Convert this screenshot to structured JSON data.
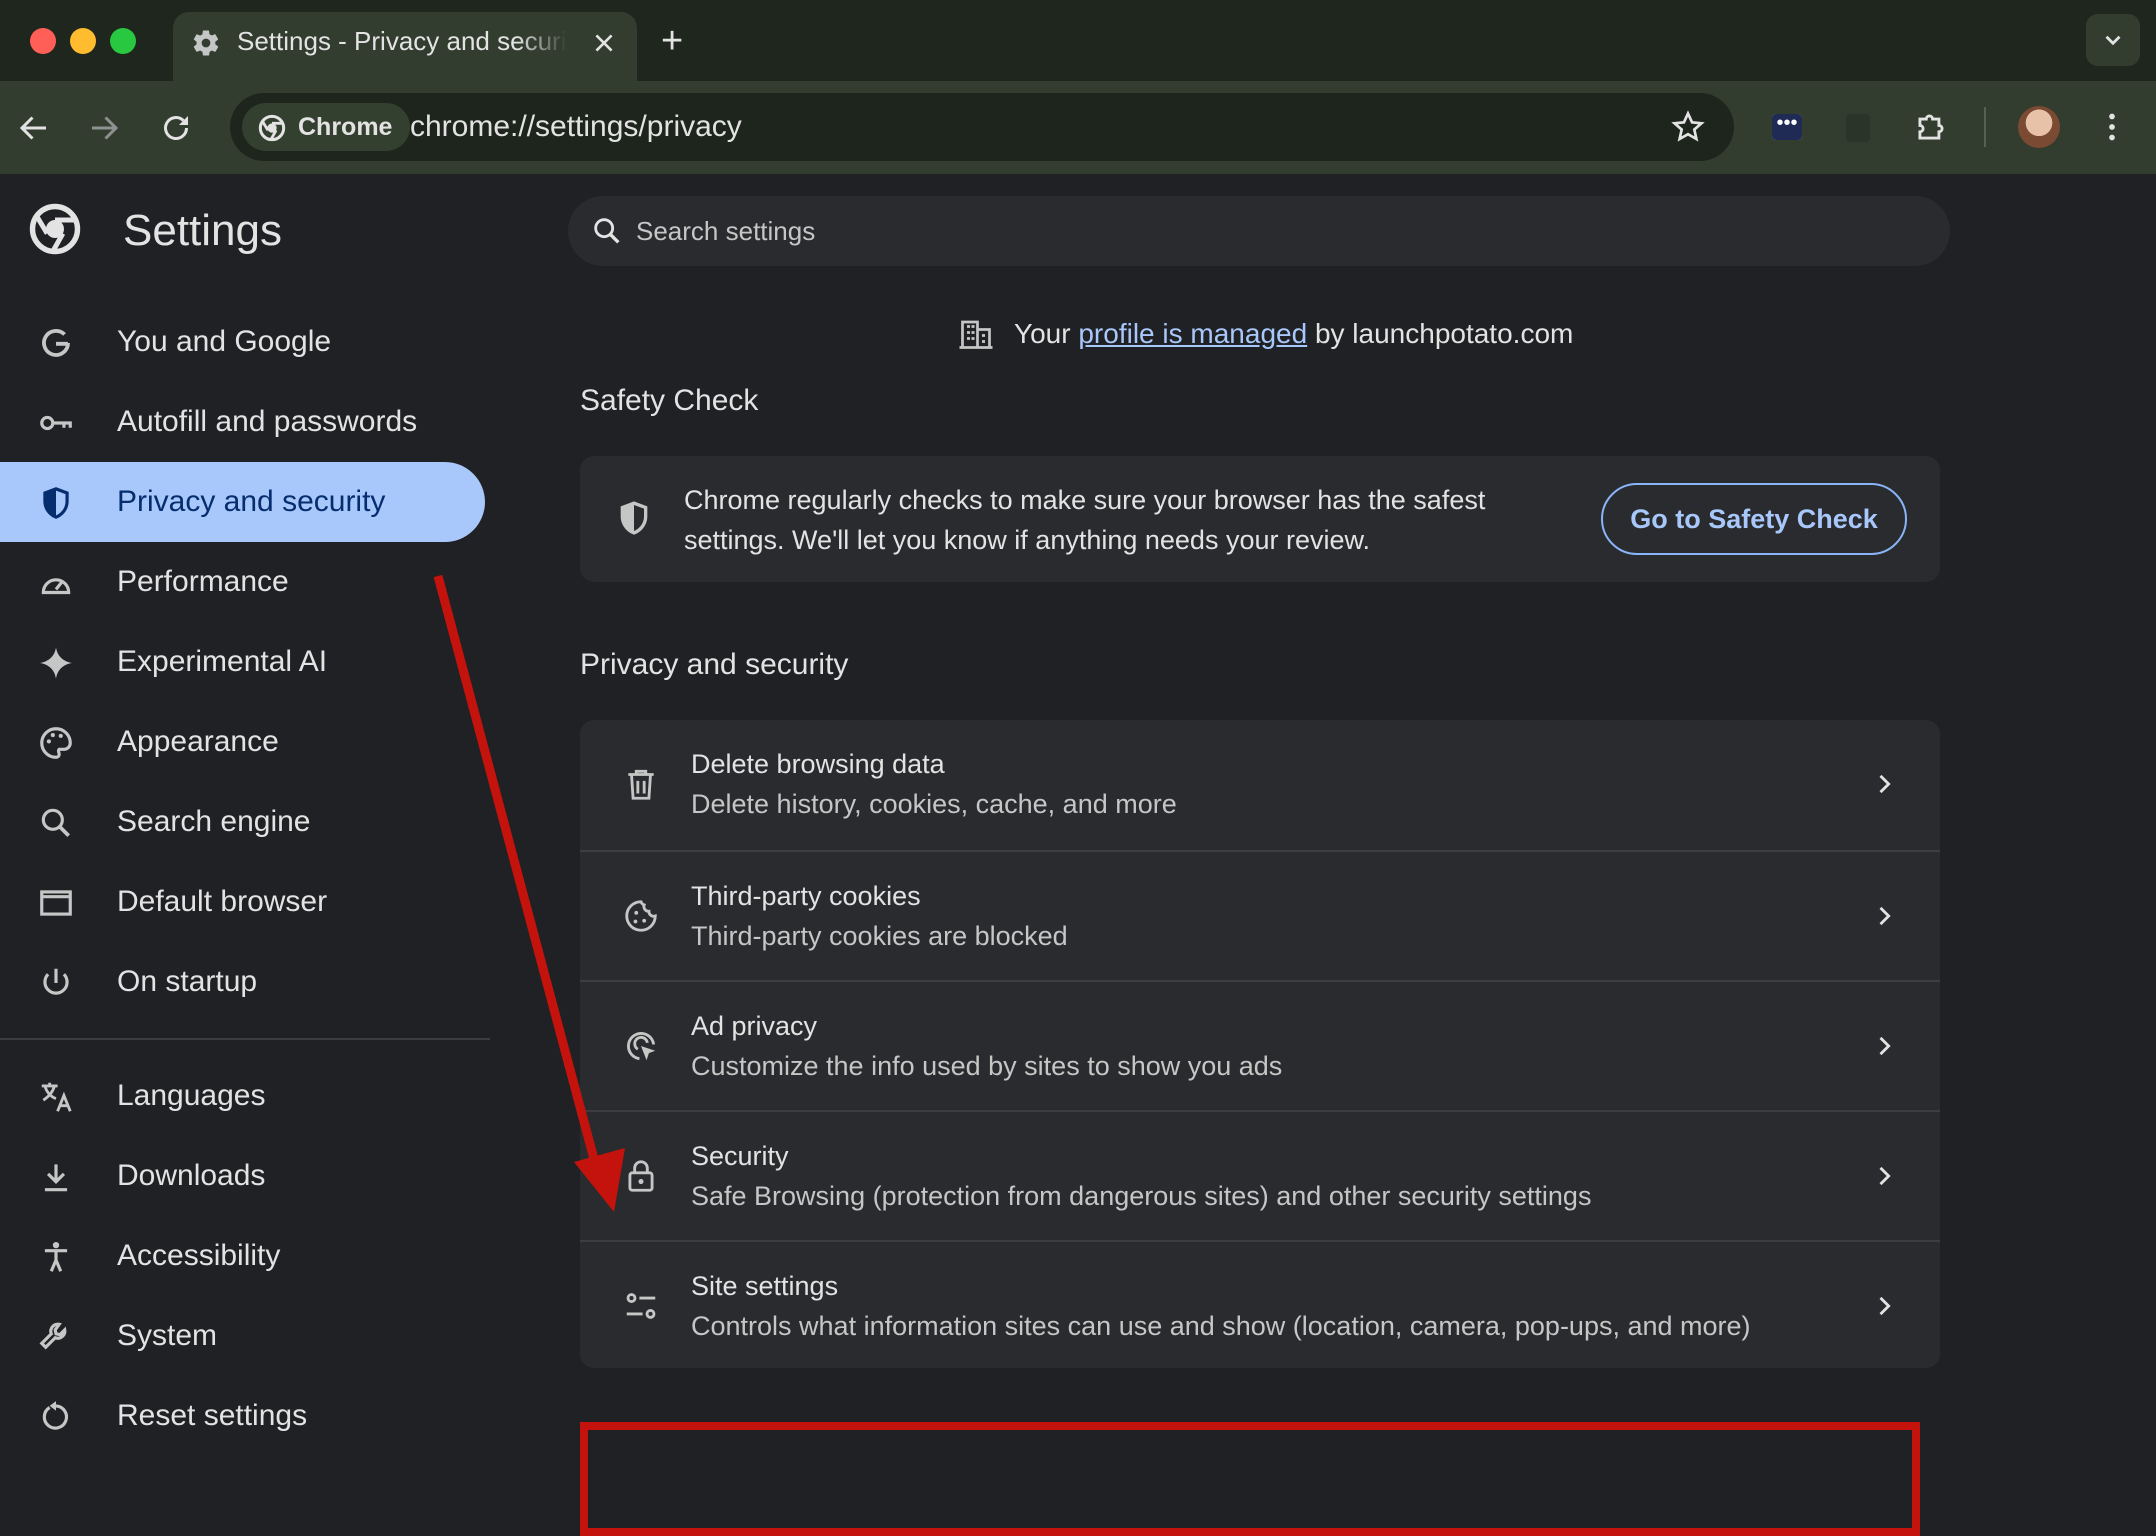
{
  "browser": {
    "traffic_lights": {
      "close": "#ff5f57",
      "minimize": "#febc2e",
      "maximize": "#28c840"
    },
    "tab": {
      "title": "Settings - Privacy and security",
      "icon": "gear-icon"
    },
    "new_tab_symbol": "+",
    "omnibox": {
      "chip_label": "Chrome",
      "url": "chrome://settings/privacy"
    }
  },
  "settings": {
    "app_title": "Settings",
    "search": {
      "placeholder": "Search settings"
    },
    "nav": {
      "items": [
        {
          "label": "You and Google",
          "icon": "google-g-icon"
        },
        {
          "label": "Autofill and passwords",
          "icon": "key-icon"
        },
        {
          "label": "Privacy and security",
          "icon": "shield-icon",
          "active": true
        },
        {
          "label": "Performance",
          "icon": "speedometer-icon"
        },
        {
          "label": "Experimental AI",
          "icon": "sparkle-icon"
        },
        {
          "label": "Appearance",
          "icon": "palette-icon"
        },
        {
          "label": "Search engine",
          "icon": "search-icon"
        },
        {
          "label": "Default browser",
          "icon": "browser-window-icon"
        },
        {
          "label": "On startup",
          "icon": "power-icon"
        }
      ],
      "secondary": [
        {
          "label": "Languages",
          "icon": "translate-icon"
        },
        {
          "label": "Downloads",
          "icon": "download-icon"
        },
        {
          "label": "Accessibility",
          "icon": "accessibility-icon"
        },
        {
          "label": "System",
          "icon": "wrench-icon"
        },
        {
          "label": "Reset settings",
          "icon": "reset-icon"
        }
      ]
    },
    "managed_notice": {
      "prefix": "Your",
      "link": "profile is managed",
      "suffix": "by launchpotato.com"
    },
    "safety_check": {
      "heading": "Safety Check",
      "line1": "Chrome regularly checks to make sure your browser has the safest",
      "line2": "settings. We'll let you know if anything needs your review.",
      "button": "Go to Safety Check"
    },
    "privacy": {
      "heading": "Privacy and security",
      "rows": [
        {
          "title": "Delete browsing data",
          "subtitle": "Delete history, cookies, cache, and more",
          "icon": "trash-icon"
        },
        {
          "title": "Third-party cookies",
          "subtitle": "Third-party cookies are blocked",
          "icon": "cookie-icon"
        },
        {
          "title": "Ad privacy",
          "subtitle": "Customize the info used by sites to show you ads",
          "icon": "ad-privacy-icon"
        },
        {
          "title": "Security",
          "subtitle": "Safe Browsing (protection from dangerous sites) and other security settings",
          "icon": "lock-icon"
        },
        {
          "title": "Site settings",
          "subtitle": "Controls what information sites can use and show (location, camera, pop-ups, and more)",
          "icon": "tune-icon"
        }
      ]
    }
  },
  "annotation": {
    "color": "#c4120c"
  }
}
